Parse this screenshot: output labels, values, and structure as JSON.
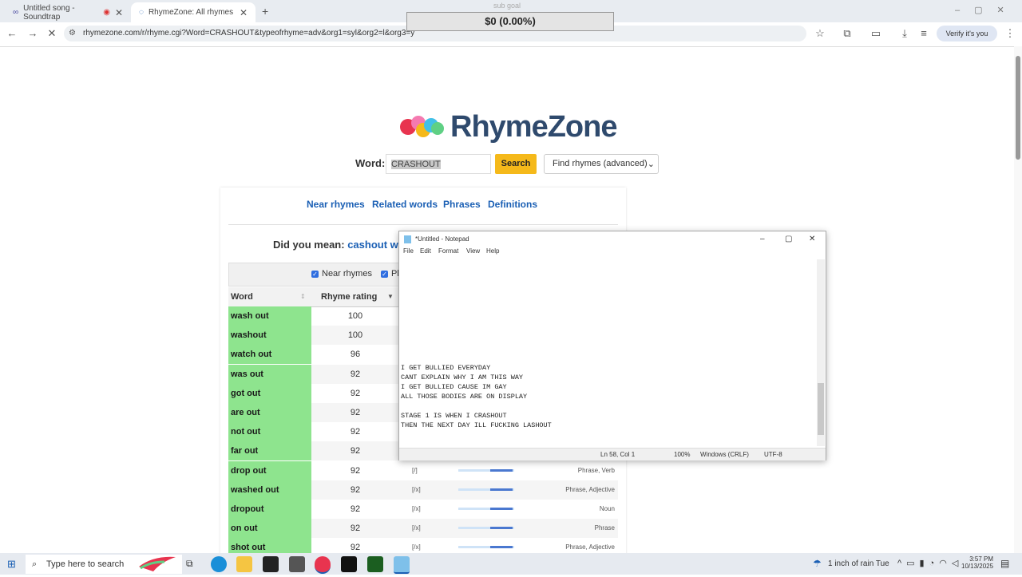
{
  "browser": {
    "tabs": [
      {
        "label": "Untitled song - Soundtrap"
      },
      {
        "label": "RhymeZone: All rhymes for CR/"
      }
    ],
    "url": "rhymezone.com/r/rhyme.cgi?Word=CRASHOUT&typeofrhyme=adv&org1=syl&org2=l&org3=y",
    "verify_label": "Verify it's you"
  },
  "overlay": {
    "label": "sub goal",
    "value": "$0 (0.00%)"
  },
  "page": {
    "logo_text": "RhymeZone",
    "word_label": "Word:",
    "word_value": "CRASHOUT",
    "search_label": "Search",
    "select_value": "Find rhymes (advanced)",
    "nav_links": [
      "Near rhymes",
      "Related words",
      "Phrases",
      "Definitions"
    ],
    "didyoumean_label": "Did you mean:",
    "didyoumean_value": "cashout wa",
    "filters": [
      "Near rhymes",
      "Pl"
    ],
    "columns": {
      "word": "Word",
      "rating": "Rhyme rating"
    },
    "rows": [
      {
        "word": "wash out",
        "rating": "100",
        "stress": "",
        "type": ""
      },
      {
        "word": "washout",
        "rating": "100",
        "stress": "",
        "type": ""
      },
      {
        "word": "watch out",
        "rating": "96",
        "stress": "",
        "type": ""
      },
      {
        "word": "was out",
        "rating": "92",
        "stress": "",
        "type": ""
      },
      {
        "word": "got out",
        "rating": "92",
        "stress": "",
        "type": ""
      },
      {
        "word": "are out",
        "rating": "92",
        "stress": "",
        "type": ""
      },
      {
        "word": "not out",
        "rating": "92",
        "stress": "",
        "type": ""
      },
      {
        "word": "far out",
        "rating": "92",
        "stress": "",
        "type": ""
      },
      {
        "word": "drop out",
        "rating": "92",
        "stress": "[/]",
        "type": "Phrase, Verb"
      },
      {
        "word": "washed out",
        "rating": "92",
        "stress": "[/x]",
        "type": "Phrase, Adjective"
      },
      {
        "word": "dropout",
        "rating": "92",
        "stress": "[/x]",
        "type": "Noun"
      },
      {
        "word": "on out",
        "rating": "92",
        "stress": "[/x]",
        "type": "Phrase"
      },
      {
        "word": "shot out",
        "rating": "92",
        "stress": "[/x]",
        "type": "Phrase, Adjective"
      }
    ]
  },
  "notepad": {
    "title": "*Untitled - Notepad",
    "menu": [
      "File",
      "Edit",
      "Format",
      "View",
      "Help"
    ],
    "lines": [
      "I GET BULLIED EVERYDAY",
      "CANT EXPLAIN WHY I AM THIS WAY",
      "I GET BULLIED CAUSE IM GAY",
      "ALL THOSE BODIES ARE ON DISPLAY",
      "",
      "STAGE 1 IS WHEN I CRASHOUT",
      "THEN THE NEXT DAY ILL FUCKING LASHOUT"
    ],
    "status": {
      "position": "Ln 58, Col 1",
      "zoom": "100%",
      "eol": "Windows (CRLF)",
      "encoding": "UTF-8"
    }
  },
  "taskbar": {
    "search_placeholder": "Type here to search",
    "weather": "1 inch of rain Tue",
    "time": "3:57 PM",
    "date": "10/13/2025"
  }
}
